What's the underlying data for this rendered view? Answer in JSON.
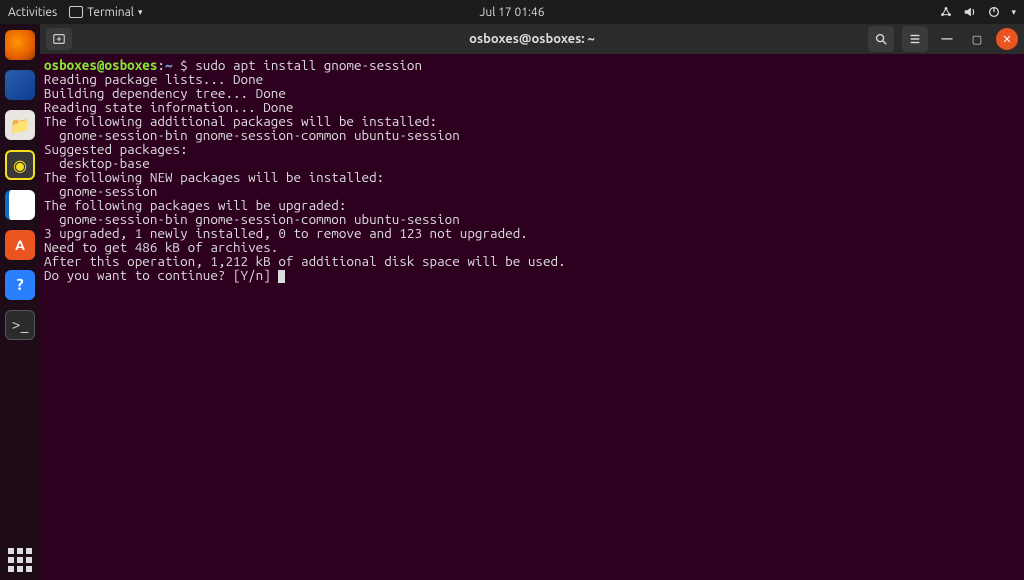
{
  "topbar": {
    "activities": "Activities",
    "app_name": "Terminal",
    "datetime": "Jul 17  01:46"
  },
  "window": {
    "title": "osboxes@osboxes: ~"
  },
  "dock": {
    "items": [
      "firefox",
      "thunderbird",
      "files",
      "rhythmbox",
      "writer",
      "software",
      "help",
      "terminal"
    ]
  },
  "terminal": {
    "prompt_user_host": "osboxes@osboxes",
    "prompt_sep": ":",
    "prompt_path": "~",
    "prompt_symbol": "$",
    "command": "sudo apt install gnome-session",
    "output_lines": [
      "Reading package lists... Done",
      "Building dependency tree... Done",
      "Reading state information... Done",
      "The following additional packages will be installed:",
      "  gnome-session-bin gnome-session-common ubuntu-session",
      "Suggested packages:",
      "  desktop-base",
      "The following NEW packages will be installed:",
      "  gnome-session",
      "The following packages will be upgraded:",
      "  gnome-session-bin gnome-session-common ubuntu-session",
      "3 upgraded, 1 newly installed, 0 to remove and 123 not upgraded.",
      "Need to get 486 kB of archives.",
      "After this operation, 1,212 kB of additional disk space will be used.",
      "Do you want to continue? [Y/n] "
    ]
  }
}
